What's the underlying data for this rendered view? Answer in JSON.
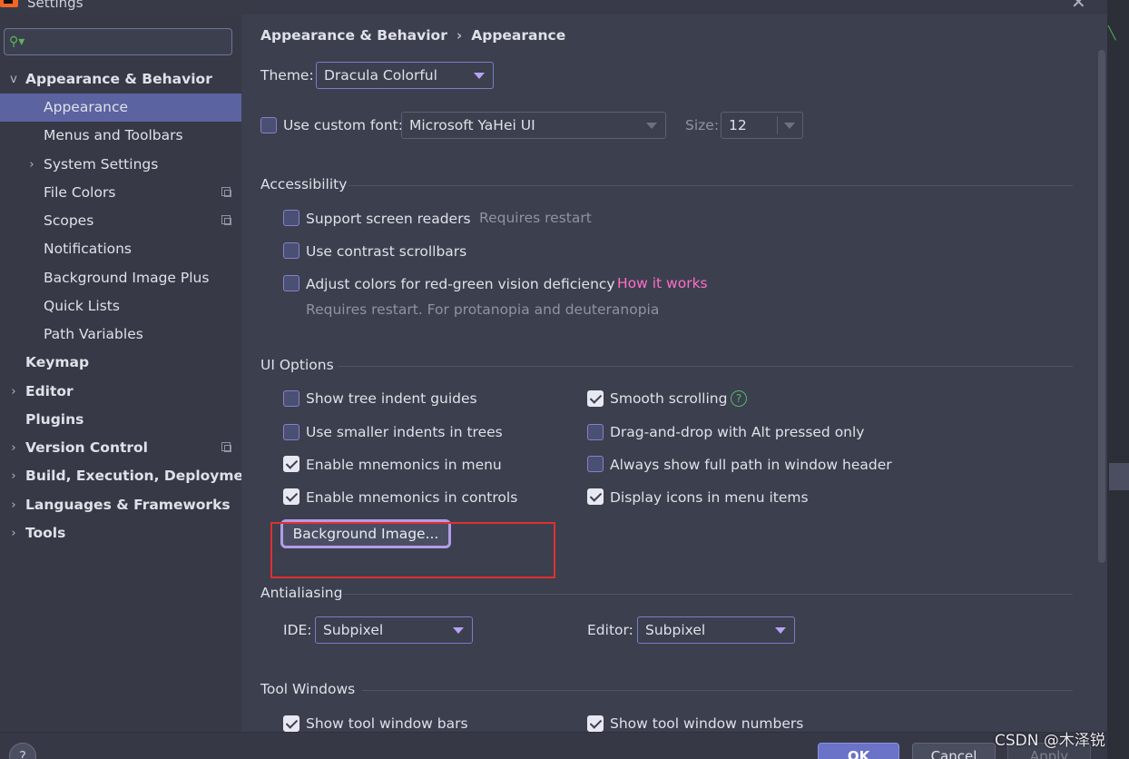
{
  "window": {
    "title": "Settings"
  },
  "search": {
    "placeholder": ""
  },
  "sidebar": {
    "items": [
      {
        "label": "Appearance & Behavior",
        "expanded": true
      },
      {
        "label": "Appearance",
        "selected": true
      },
      {
        "label": "Menus and Toolbars"
      },
      {
        "label": "System Settings"
      },
      {
        "label": "File Colors"
      },
      {
        "label": "Scopes"
      },
      {
        "label": "Notifications"
      },
      {
        "label": "Background Image Plus"
      },
      {
        "label": "Quick Lists"
      },
      {
        "label": "Path Variables"
      },
      {
        "label": "Keymap"
      },
      {
        "label": "Editor"
      },
      {
        "label": "Plugins"
      },
      {
        "label": "Version Control"
      },
      {
        "label": "Build, Execution, Deployment"
      },
      {
        "label": "Languages & Frameworks"
      },
      {
        "label": "Tools"
      }
    ]
  },
  "breadcrumb": {
    "parent": "Appearance & Behavior",
    "separator": "›",
    "current": "Appearance"
  },
  "theme": {
    "label": "Theme:",
    "value": "Dracula Colorful"
  },
  "font": {
    "checkbox_label": "Use custom font:",
    "value": "Microsoft YaHei UI",
    "size_label": "Size:",
    "size_value": "12"
  },
  "accessibility": {
    "title": "Accessibility",
    "screen_readers": "Support screen readers",
    "requires_restart": "Requires restart",
    "contrast_scrollbars": "Use contrast scrollbars",
    "red_green": "Adjust colors for red-green vision deficiency",
    "how_it_works": "How it works",
    "red_green_note": "Requires restart. For protanopia and deuteranopia"
  },
  "ui_options": {
    "title": "UI Options",
    "tree_indent_guides": "Show tree indent guides",
    "smaller_indents": "Use smaller indents in trees",
    "mnemonics_menu": "Enable mnemonics in menu",
    "mnemonics_controls": "Enable mnemonics in controls",
    "smooth_scrolling": "Smooth scrolling",
    "drag_drop_alt": "Drag-and-drop with Alt pressed only",
    "full_path_header": "Always show full path in window header",
    "icons_menu_items": "Display icons in menu items",
    "background_image_button": "Background Image...",
    "help_glyph": "?"
  },
  "antialiasing": {
    "title": "Antialiasing",
    "ide_label": "IDE:",
    "ide_value": "Subpixel",
    "editor_label": "Editor:",
    "editor_value": "Subpixel"
  },
  "tool_windows": {
    "title": "Tool Windows",
    "show_bars": "Show tool window bars",
    "show_numbers": "Show tool window numbers"
  },
  "buttons": {
    "ok": "OK",
    "cancel": "Cancel",
    "apply": "Apply",
    "help": "?"
  },
  "watermark": "CSDN @木泽锐",
  "colors": {
    "accent": "#5b64a0",
    "link": "#ff6ec7",
    "highlight_box": "#e03030",
    "button_outline": "#b39ce8"
  }
}
